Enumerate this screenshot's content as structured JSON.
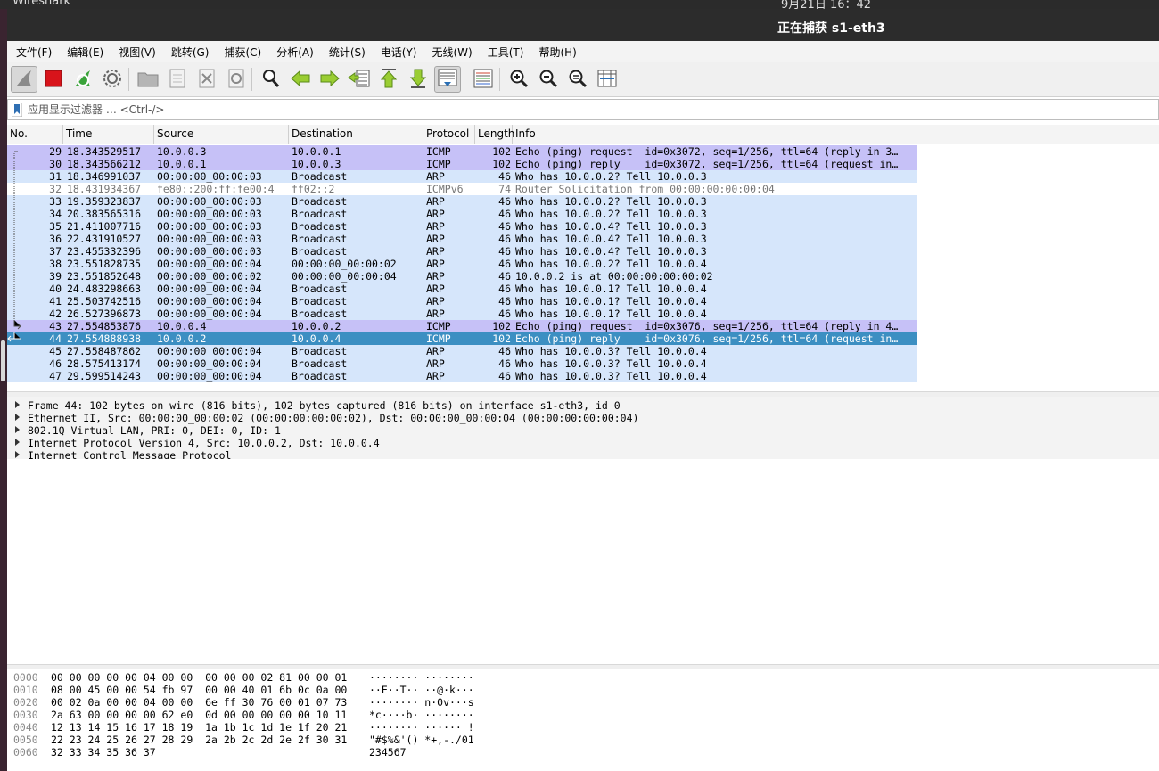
{
  "desktop": {
    "app_name": "Wireshark",
    "clock": "9月21日 16：42"
  },
  "window": {
    "title": "正在捕获 s1-eth3"
  },
  "menu": [
    "文件(F)",
    "编辑(E)",
    "视图(V)",
    "跳转(G)",
    "捕获(C)",
    "分析(A)",
    "统计(S)",
    "电话(Y)",
    "无线(W)",
    "工具(T)",
    "帮助(H)"
  ],
  "toolbar": [
    {
      "name": "start-capture",
      "icon": "shark-fin-icon",
      "active": true
    },
    {
      "name": "stop-capture",
      "icon": "stop-icon"
    },
    {
      "name": "restart-capture",
      "icon": "restart-icon"
    },
    {
      "name": "capture-options",
      "icon": "gear-icon"
    },
    {
      "name": "open-file",
      "icon": "folder-icon"
    },
    {
      "name": "save-file",
      "icon": "save-icon"
    },
    {
      "name": "close-file",
      "icon": "close-file-icon"
    },
    {
      "name": "reload-file",
      "icon": "reload-icon"
    },
    {
      "name": "find-packet",
      "icon": "magnifier-icon"
    },
    {
      "name": "go-back",
      "icon": "arrow-left-icon"
    },
    {
      "name": "go-forward",
      "icon": "arrow-right-icon"
    },
    {
      "name": "go-to-packet",
      "icon": "go-to-packet-icon"
    },
    {
      "name": "first-packet",
      "icon": "arrow-up-icon"
    },
    {
      "name": "last-packet",
      "icon": "arrow-down-icon"
    },
    {
      "name": "auto-scroll",
      "icon": "auto-scroll-icon",
      "active": true
    },
    {
      "name": "colorize",
      "icon": "colorize-icon"
    },
    {
      "name": "zoom-in",
      "icon": "zoom-in-icon"
    },
    {
      "name": "zoom-out",
      "icon": "zoom-out-icon"
    },
    {
      "name": "normal-size",
      "icon": "zoom-reset-icon"
    },
    {
      "name": "resize-columns",
      "icon": "resize-columns-icon"
    }
  ],
  "filter": {
    "placeholder": "应用显示过滤器 … <Ctrl-/>"
  },
  "columns": [
    "No.",
    "Time",
    "Source",
    "Destination",
    "Protocol",
    "Length",
    "Info"
  ],
  "colors": {
    "icmp": "#c6c1f7",
    "arp": "#d6e6fb",
    "ipv6": "#ffffff",
    "selected": "#3c8fc2",
    "details_bg": "#f3f3f3"
  },
  "packets": [
    {
      "no": "29",
      "time": "18.343529517",
      "src": "10.0.0.3",
      "dst": "10.0.0.1",
      "proto": "ICMP",
      "len": "102",
      "info": "Echo (ping) request  id=0x3072, seq=1/256, ttl=64 (reply in 3…",
      "kind": "icmp",
      "tree": "start"
    },
    {
      "no": "30",
      "time": "18.343566212",
      "src": "10.0.0.1",
      "dst": "10.0.0.3",
      "proto": "ICMP",
      "len": "102",
      "info": "Echo (ping) reply    id=0x3072, seq=1/256, ttl=64 (request in…",
      "kind": "icmp",
      "tree": "mid"
    },
    {
      "no": "31",
      "time": "18.346991037",
      "src": "00:00:00_00:00:03",
      "dst": "Broadcast",
      "proto": "ARP",
      "len": "46",
      "info": "Who has 10.0.0.2? Tell 10.0.0.3",
      "kind": "arp",
      "tree": "mid"
    },
    {
      "no": "32",
      "time": "18.431934367",
      "src": "fe80::200:ff:fe00:4",
      "dst": "ff02::2",
      "proto": "ICMPv6",
      "len": "74",
      "info": "Router Solicitation from 00:00:00:00:00:04",
      "kind": "ipv6",
      "tree": "mid"
    },
    {
      "no": "33",
      "time": "19.359323837",
      "src": "00:00:00_00:00:03",
      "dst": "Broadcast",
      "proto": "ARP",
      "len": "46",
      "info": "Who has 10.0.0.2? Tell 10.0.0.3",
      "kind": "arp",
      "tree": "mid"
    },
    {
      "no": "34",
      "time": "20.383565316",
      "src": "00:00:00_00:00:03",
      "dst": "Broadcast",
      "proto": "ARP",
      "len": "46",
      "info": "Who has 10.0.0.2? Tell 10.0.0.3",
      "kind": "arp",
      "tree": "mid"
    },
    {
      "no": "35",
      "time": "21.411007716",
      "src": "00:00:00_00:00:03",
      "dst": "Broadcast",
      "proto": "ARP",
      "len": "46",
      "info": "Who has 10.0.0.4? Tell 10.0.0.3",
      "kind": "arp",
      "tree": "mid"
    },
    {
      "no": "36",
      "time": "22.431910527",
      "src": "00:00:00_00:00:03",
      "dst": "Broadcast",
      "proto": "ARP",
      "len": "46",
      "info": "Who has 10.0.0.4? Tell 10.0.0.3",
      "kind": "arp",
      "tree": "mid"
    },
    {
      "no": "37",
      "time": "23.455332396",
      "src": "00:00:00_00:00:03",
      "dst": "Broadcast",
      "proto": "ARP",
      "len": "46",
      "info": "Who has 10.0.0.4? Tell 10.0.0.3",
      "kind": "arp",
      "tree": "mid"
    },
    {
      "no": "38",
      "time": "23.551828735",
      "src": "00:00:00_00:00:04",
      "dst": "00:00:00_00:00:02",
      "proto": "ARP",
      "len": "46",
      "info": "Who has 10.0.0.2? Tell 10.0.0.4",
      "kind": "arp",
      "tree": "mid"
    },
    {
      "no": "39",
      "time": "23.551852648",
      "src": "00:00:00_00:00:02",
      "dst": "00:00:00_00:00:04",
      "proto": "ARP",
      "len": "46",
      "info": "10.0.0.2 is at 00:00:00:00:00:02",
      "kind": "arp",
      "tree": "mid"
    },
    {
      "no": "40",
      "time": "24.483298663",
      "src": "00:00:00_00:00:04",
      "dst": "Broadcast",
      "proto": "ARP",
      "len": "46",
      "info": "Who has 10.0.0.1? Tell 10.0.0.4",
      "kind": "arp",
      "tree": "mid"
    },
    {
      "no": "41",
      "time": "25.503742516",
      "src": "00:00:00_00:00:04",
      "dst": "Broadcast",
      "proto": "ARP",
      "len": "46",
      "info": "Who has 10.0.0.1? Tell 10.0.0.4",
      "kind": "arp",
      "tree": "mid"
    },
    {
      "no": "42",
      "time": "26.527396873",
      "src": "00:00:00_00:00:04",
      "dst": "Broadcast",
      "proto": "ARP",
      "len": "46",
      "info": "Who has 10.0.0.1? Tell 10.0.0.4",
      "kind": "arp",
      "tree": "mid"
    },
    {
      "no": "43",
      "time": "27.554853876",
      "src": "10.0.0.4",
      "dst": "10.0.0.2",
      "proto": "ICMP",
      "len": "102",
      "info": "Echo (ping) request  id=0x3076, seq=1/256, ttl=64 (reply in 4…",
      "kind": "icmp",
      "tree": "req"
    },
    {
      "no": "44",
      "time": "27.554888938",
      "src": "10.0.0.2",
      "dst": "10.0.0.4",
      "proto": "ICMP",
      "len": "102",
      "info": "Echo (ping) reply    id=0x3076, seq=1/256, ttl=64 (request in…",
      "kind": "selected",
      "tree": "rep"
    },
    {
      "no": "45",
      "time": "27.558487862",
      "src": "00:00:00_00:00:04",
      "dst": "Broadcast",
      "proto": "ARP",
      "len": "46",
      "info": "Who has 10.0.0.3? Tell 10.0.0.4",
      "kind": "arp",
      "tree": ""
    },
    {
      "no": "46",
      "time": "28.575413174",
      "src": "00:00:00_00:00:04",
      "dst": "Broadcast",
      "proto": "ARP",
      "len": "46",
      "info": "Who has 10.0.0.3? Tell 10.0.0.4",
      "kind": "arp",
      "tree": ""
    },
    {
      "no": "47",
      "time": "29.599514243",
      "src": "00:00:00_00:00:04",
      "dst": "Broadcast",
      "proto": "ARP",
      "len": "46",
      "info": "Who has 10.0.0.3? Tell 10.0.0.4",
      "kind": "arp",
      "tree": ""
    }
  ],
  "details": [
    "Frame 44: 102 bytes on wire (816 bits), 102 bytes captured (816 bits) on interface s1-eth3, id 0",
    "Ethernet II, Src: 00:00:00_00:00:02 (00:00:00:00:00:02), Dst: 00:00:00_00:00:04 (00:00:00:00:00:04)",
    "802.1Q Virtual LAN, PRI: 0, DEI: 0, ID: 1",
    "Internet Protocol Version 4, Src: 10.0.0.2, Dst: 10.0.0.4",
    "Internet Control Message Protocol"
  ],
  "bytes": [
    {
      "offset": "0000",
      "hex": "00 00 00 00 00 04 00 00  00 00 00 02 81 00 00 01",
      "ascii": "········ ········"
    },
    {
      "offset": "0010",
      "hex": "08 00 45 00 00 54 fb 97  00 00 40 01 6b 0c 0a 00",
      "ascii": "··E··T·· ··@·k···"
    },
    {
      "offset": "0020",
      "hex": "00 02 0a 00 00 04 00 00  6e ff 30 76 00 01 07 73",
      "ascii": "········ n·0v···s"
    },
    {
      "offset": "0030",
      "hex": "2a 63 00 00 00 00 62 e0  0d 00 00 00 00 00 10 11",
      "ascii": "*c····b· ········"
    },
    {
      "offset": "0040",
      "hex": "12 13 14 15 16 17 18 19  1a 1b 1c 1d 1e 1f 20 21",
      "ascii": "········ ······ !"
    },
    {
      "offset": "0050",
      "hex": "22 23 24 25 26 27 28 29  2a 2b 2c 2d 2e 2f 30 31",
      "ascii": "\"#$%&'() *+,-./01"
    },
    {
      "offset": "0060",
      "hex": "32 33 34 35 36 37",
      "ascii": "234567"
    }
  ]
}
